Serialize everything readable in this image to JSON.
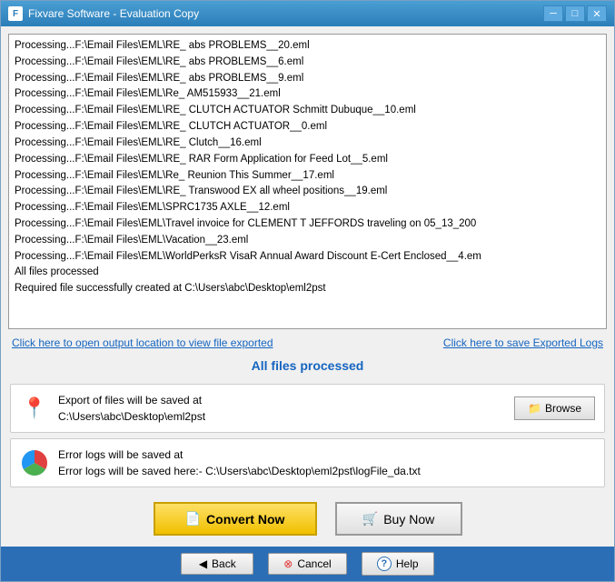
{
  "window": {
    "title": "Fixvare Software - Evaluation Copy",
    "icon": "F"
  },
  "titlebar": {
    "minimize_label": "─",
    "maximize_label": "□",
    "close_label": "✕"
  },
  "log": {
    "lines": [
      "Processing...F:\\Email Files\\EML\\RE_ abs PROBLEMS__20.eml",
      "Processing...F:\\Email Files\\EML\\RE_ abs PROBLEMS__6.eml",
      "Processing...F:\\Email Files\\EML\\RE_ abs PROBLEMS__9.eml",
      "Processing...F:\\Email Files\\EML\\Re_ AM515933__21.eml",
      "Processing...F:\\Email Files\\EML\\RE_ CLUTCH ACTUATOR Schmitt Dubuque__10.eml",
      "Processing...F:\\Email Files\\EML\\RE_ CLUTCH ACTUATOR__0.eml",
      "Processing...F:\\Email Files\\EML\\RE_ Clutch__16.eml",
      "Processing...F:\\Email Files\\EML\\RE_ RAR Form Application for Feed Lot__5.eml",
      "Processing...F:\\Email Files\\EML\\Re_ Reunion This Summer__17.eml",
      "Processing...F:\\Email Files\\EML\\RE_ Transwood EX all wheel positions__19.eml",
      "Processing...F:\\Email Files\\EML\\SPRC1735 AXLE__12.eml",
      "Processing...F:\\Email Files\\EML\\Travel invoice for CLEMENT T JEFFORDS traveling on 05_13_200",
      "Processing...F:\\Email Files\\EML\\Vacation__23.eml",
      "Processing...F:\\Email Files\\EML\\WorldPerksR VisaR Annual Award Discount E-Cert Enclosed__4.em",
      "All files processed",
      "",
      "Required file successfully created at C:\\Users\\abc\\Desktop\\eml2pst"
    ]
  },
  "links": {
    "open_output": "Click here to open output location to view file exported",
    "save_logs": "Click here to save Exported Logs"
  },
  "status": {
    "all_files": "All files processed"
  },
  "export_info": {
    "label_line1": "Export of files will be saved at",
    "label_line2": "C:\\Users\\abc\\Desktop\\eml2pst",
    "browse_label": "Browse",
    "browse_icon": "📁"
  },
  "error_info": {
    "label_line1": "Error logs will be saved at",
    "label_line2": "Error logs will be saved here:- C:\\Users\\abc\\Desktop\\eml2pst\\logFile_da.txt"
  },
  "actions": {
    "convert_icon": "📄",
    "convert_label": "Convert Now",
    "buy_icon": "🛒",
    "buy_label": "Buy Now"
  },
  "footer": {
    "back_icon": "◀",
    "back_label": "Back",
    "cancel_icon": "⊗",
    "cancel_label": "Cancel",
    "help_icon": "?",
    "help_label": "Help"
  }
}
